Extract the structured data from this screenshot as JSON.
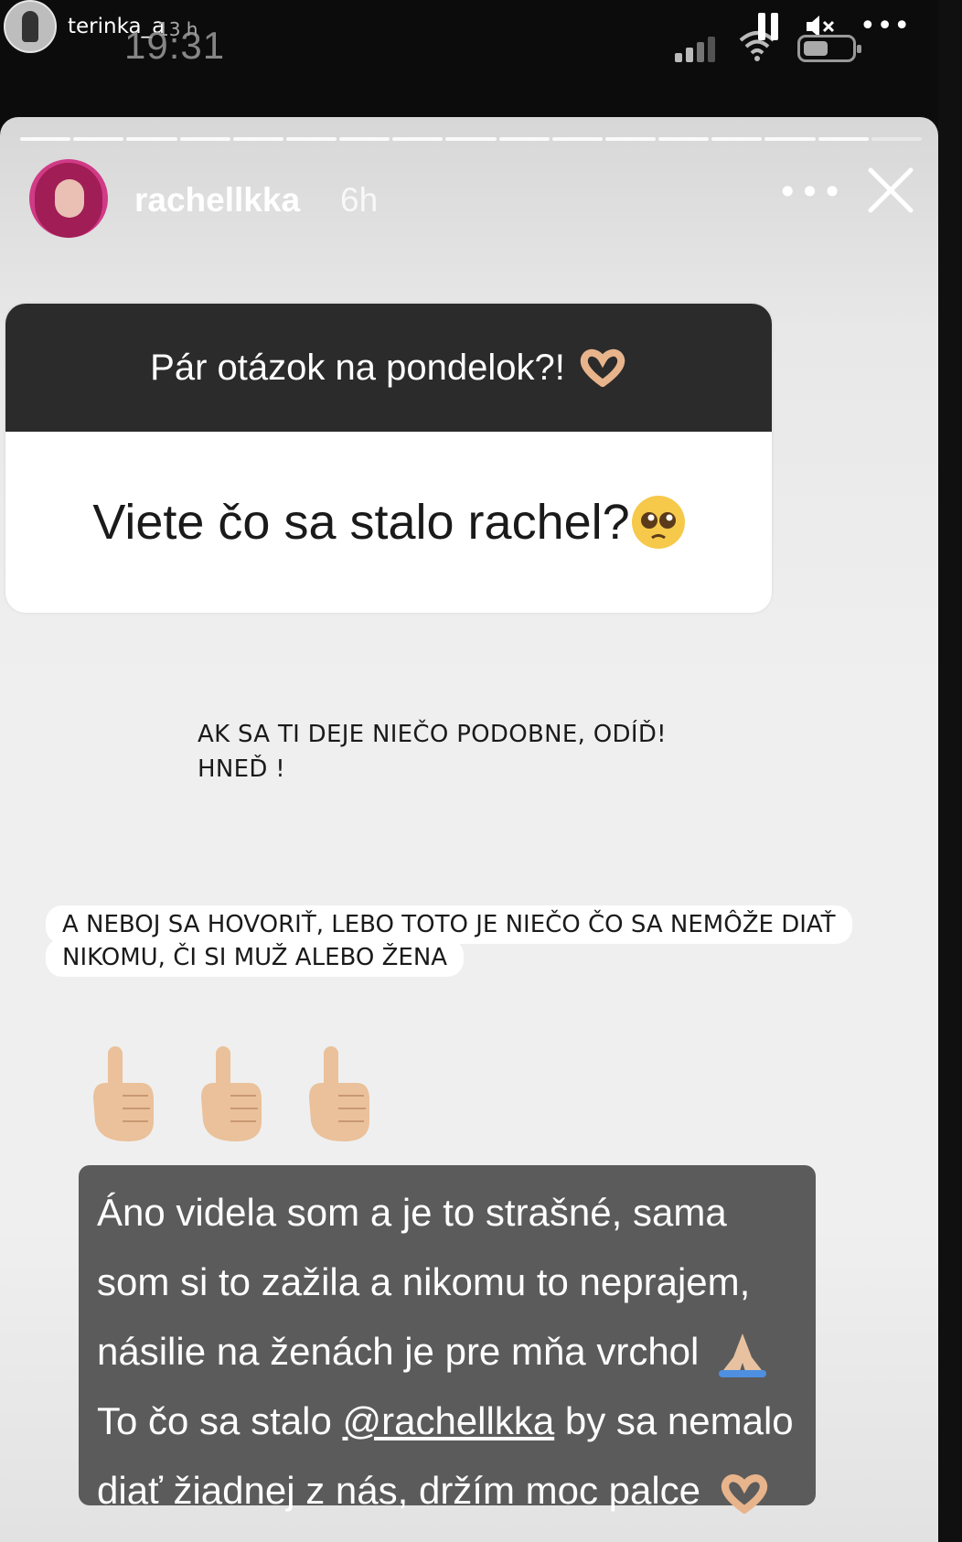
{
  "status_bar": {
    "username": "terinka_a",
    "post_age": "13 h",
    "clock": "19:31",
    "more": "•••"
  },
  "story": {
    "username": "rachellkka",
    "age": "6h",
    "more": "•••",
    "progress_segments": 17
  },
  "question_card": {
    "header": "Pár otázok na pondelok?!",
    "header_emoji": "heart-hands",
    "question": "Viete čo sa stalo rachel?",
    "question_emoji": "pleading-face"
  },
  "warning_text": {
    "line1": "AK SA TI DEJE NIEČO PODOBNE, ODÍĎ!",
    "line2": "HNEĎ !"
  },
  "caption": {
    "line1": "A NEBOJ SA HOVORIŤ, LEBO TOTO JE NIEČO ČO SA NEMÔŽE DIAŤ",
    "line2": "NIKOMU, ČI SI MUŽ ALEBO ŽENA"
  },
  "pointing_emojis": [
    "pointing-up-hand",
    "pointing-up-hand",
    "pointing-up-hand"
  ],
  "answer": {
    "line1": "Áno videla som a je to strašné, sama",
    "line2": "som si to zažila a nikomu to neprajem,",
    "line3": "násilie na ženách je pre mňa vrchol",
    "line4_pre": "To čo sa stalo ",
    "mention": "@rachellkka",
    "line4_post": " by sa nemalo",
    "line5": "diať žiadnej z nás, držím moc palce",
    "line3_emoji": "folded-hands",
    "line5_emoji": "heart-hands"
  },
  "colors": {
    "question_header_bg": "#2b2b2b",
    "answer_bg": "#5b5b5b",
    "story_bg": "#efefef",
    "status_bar_bg": "#0c0c0c"
  }
}
